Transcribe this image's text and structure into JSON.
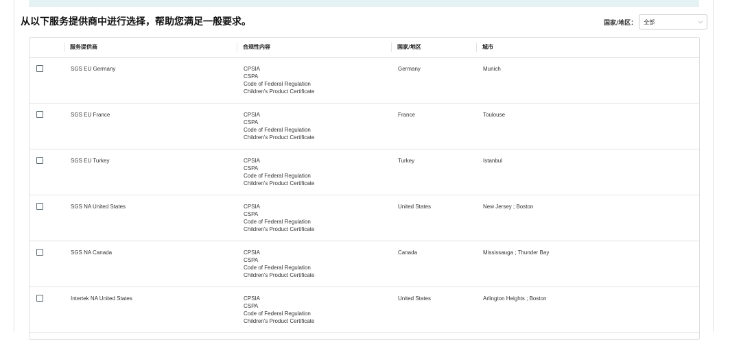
{
  "heading": "从以下服务提供商中进行选择，帮助您满足一般要求。",
  "filter": {
    "label": "国家/地区：",
    "selected": "全部"
  },
  "table": {
    "headers": {
      "provider": "服务提供商",
      "compliance": "合规性内容",
      "country": "国家/地区",
      "city": "城市"
    },
    "rows": [
      {
        "provider": "SGS EU Germany",
        "compliance": [
          "CPSIA",
          "CSPA",
          "Code of Federal Regulation",
          "Children's Product Certificate"
        ],
        "country": "Germany",
        "city": "Munich"
      },
      {
        "provider": "SGS EU France",
        "compliance": [
          "CPSIA",
          "CSPA",
          "Code of Federal Regulation",
          "Children's Product Certificate"
        ],
        "country": "France",
        "city": "Toulouse"
      },
      {
        "provider": "SGS EU Turkey",
        "compliance": [
          "CPSIA",
          "CSPA",
          "Code of Federal Regulation",
          "Children's Product Certificate"
        ],
        "country": "Turkey",
        "city": "Istanbul"
      },
      {
        "provider": "SGS NA United States",
        "compliance": [
          "CPSIA",
          "CSPA",
          "Code of Federal Regulation",
          "Children's Product Certificate"
        ],
        "country": "United States",
        "city": "New Jersey ; Boston"
      },
      {
        "provider": "SGS NA Canada",
        "compliance": [
          "CPSIA",
          "CSPA",
          "Code of Federal Regulation",
          "Children's Product Certificate"
        ],
        "country": "Canada",
        "city": "Mississauga ; Thunder Bay"
      },
      {
        "provider": "Intertek NA United States",
        "compliance": [
          "CPSIA",
          "CSPA",
          "Code of Federal Regulation",
          "Children's Product Certificate"
        ],
        "country": "United States",
        "city": "Arlington Heights ; Boston"
      }
    ]
  },
  "colors": {
    "banner": "#e5f2f3",
    "border": "#dddddd",
    "checkbox_border": "#5a6a72"
  }
}
